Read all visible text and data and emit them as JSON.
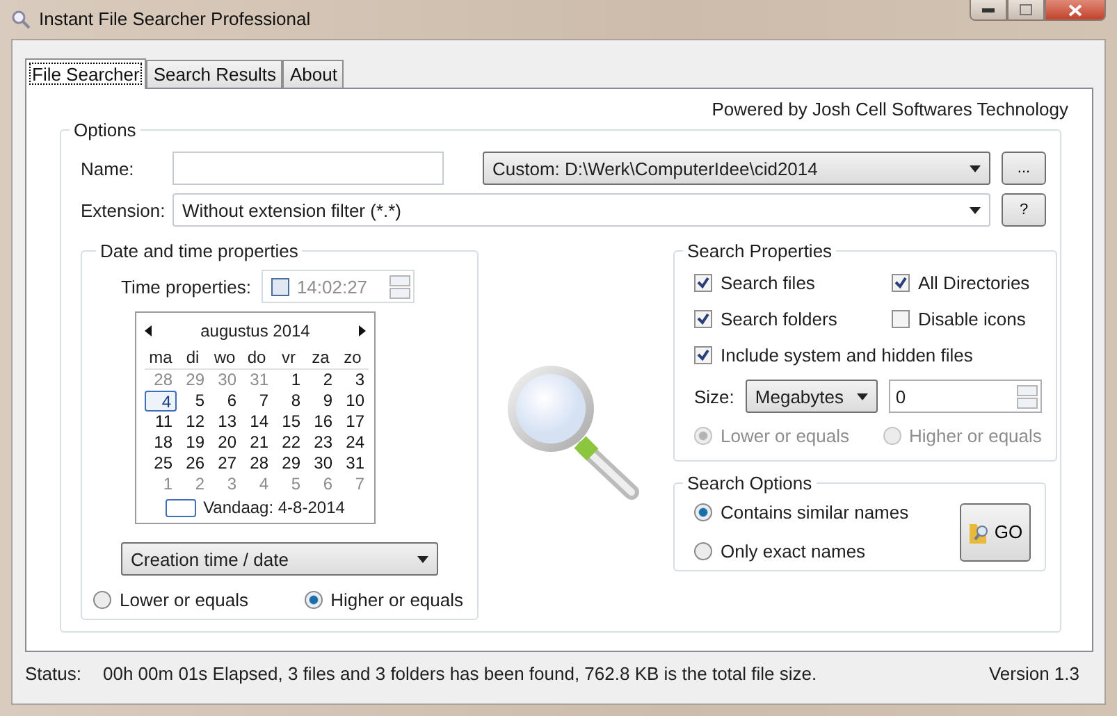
{
  "window": {
    "title": "Instant File Searcher Professional"
  },
  "tabs": [
    {
      "label": "File Searcher",
      "selected": true
    },
    {
      "label": "Search Results",
      "selected": false
    },
    {
      "label": "About",
      "selected": false
    }
  ],
  "powered_by": "Powered by Josh Cell Softwares Technology",
  "options": {
    "title": "Options",
    "name_label": "Name:",
    "location": "Custom: D:\\Werk\\ComputerIdee\\cid2014",
    "browse_button": "...",
    "extension_label": "Extension:",
    "extension": "Without extension filter (*.*)",
    "help_button": "?"
  },
  "date_time": {
    "title": "Date and time properties",
    "time_label": "Time properties:",
    "time_enabled": false,
    "time_value": "14:02:27",
    "calendar": {
      "month": "augustus 2014",
      "weekdays": [
        "ma",
        "di",
        "wo",
        "do",
        "vr",
        "za",
        "zo"
      ],
      "weeks": [
        [
          {
            "day": "28",
            "other_month": true,
            "selected": false
          },
          {
            "day": "29",
            "other_month": true,
            "selected": false
          },
          {
            "day": "30",
            "other_month": true,
            "selected": false
          },
          {
            "day": "31",
            "other_month": true,
            "selected": false
          },
          {
            "day": "1",
            "other_month": false,
            "selected": false
          },
          {
            "day": "2",
            "other_month": false,
            "selected": false
          },
          {
            "day": "3",
            "other_month": false,
            "selected": false
          }
        ],
        [
          {
            "day": "4",
            "other_month": false,
            "selected": true
          },
          {
            "day": "5",
            "other_month": false,
            "selected": false
          },
          {
            "day": "6",
            "other_month": false,
            "selected": false
          },
          {
            "day": "7",
            "other_month": false,
            "selected": false
          },
          {
            "day": "8",
            "other_month": false,
            "selected": false
          },
          {
            "day": "9",
            "other_month": false,
            "selected": false
          },
          {
            "day": "10",
            "other_month": false,
            "selected": false
          }
        ],
        [
          {
            "day": "11",
            "other_month": false,
            "selected": false
          },
          {
            "day": "12",
            "other_month": false,
            "selected": false
          },
          {
            "day": "13",
            "other_month": false,
            "selected": false
          },
          {
            "day": "14",
            "other_month": false,
            "selected": false
          },
          {
            "day": "15",
            "other_month": false,
            "selected": false
          },
          {
            "day": "16",
            "other_month": false,
            "selected": false
          },
          {
            "day": "17",
            "other_month": false,
            "selected": false
          }
        ],
        [
          {
            "day": "18",
            "other_month": false,
            "selected": false
          },
          {
            "day": "19",
            "other_month": false,
            "selected": false
          },
          {
            "day": "20",
            "other_month": false,
            "selected": false
          },
          {
            "day": "21",
            "other_month": false,
            "selected": false
          },
          {
            "day": "22",
            "other_month": false,
            "selected": false
          },
          {
            "day": "23",
            "other_month": false,
            "selected": false
          },
          {
            "day": "24",
            "other_month": false,
            "selected": false
          }
        ],
        [
          {
            "day": "25",
            "other_month": false,
            "selected": false
          },
          {
            "day": "26",
            "other_month": false,
            "selected": false
          },
          {
            "day": "27",
            "other_month": false,
            "selected": false
          },
          {
            "day": "28",
            "other_month": false,
            "selected": false
          },
          {
            "day": "29",
            "other_month": false,
            "selected": false
          },
          {
            "day": "30",
            "other_month": false,
            "selected": false
          },
          {
            "day": "31",
            "other_month": false,
            "selected": false
          }
        ],
        [
          {
            "day": "1",
            "other_month": true,
            "selected": false
          },
          {
            "day": "2",
            "other_month": true,
            "selected": false
          },
          {
            "day": "3",
            "other_month": true,
            "selected": false
          },
          {
            "day": "4",
            "other_month": true,
            "selected": false
          },
          {
            "day": "5",
            "other_month": true,
            "selected": false
          },
          {
            "day": "6",
            "other_month": true,
            "selected": false
          },
          {
            "day": "7",
            "other_month": true,
            "selected": false
          }
        ]
      ],
      "today": "Vandaag: 4-8-2014"
    },
    "date_type": "Creation time / date",
    "compare": [
      {
        "label": "Lower or equals",
        "selected": false,
        "disabled": false
      },
      {
        "label": "Higher or equals",
        "selected": true,
        "disabled": false
      }
    ]
  },
  "search_properties": {
    "title": "Search Properties",
    "checkboxes": [
      {
        "label": "Search files",
        "checked": true
      },
      {
        "label": "All Directories",
        "checked": true
      },
      {
        "label": "Search folders",
        "checked": true
      },
      {
        "label": "Disable icons",
        "checked": false
      },
      {
        "label": "Include system and hidden files",
        "checked": true
      }
    ],
    "size_label": "Size:",
    "size_unit": "Megabytes",
    "size_value": "0",
    "compare": [
      {
        "label": "Lower or equals",
        "selected": true,
        "disabled": true
      },
      {
        "label": "Higher or equals",
        "selected": false,
        "disabled": true
      }
    ]
  },
  "search_options": {
    "title": "Search Options",
    "modes": [
      {
        "label": "Contains similar names",
        "selected": true
      },
      {
        "label": "Only exact names",
        "selected": false
      }
    ],
    "go_button": "GO"
  },
  "status": {
    "label": "Status:",
    "text": "00h 00m 01s Elapsed, 3 files and 3 folders has been found, 762.8 KB is the total file size.",
    "version": "Version 1.3"
  }
}
